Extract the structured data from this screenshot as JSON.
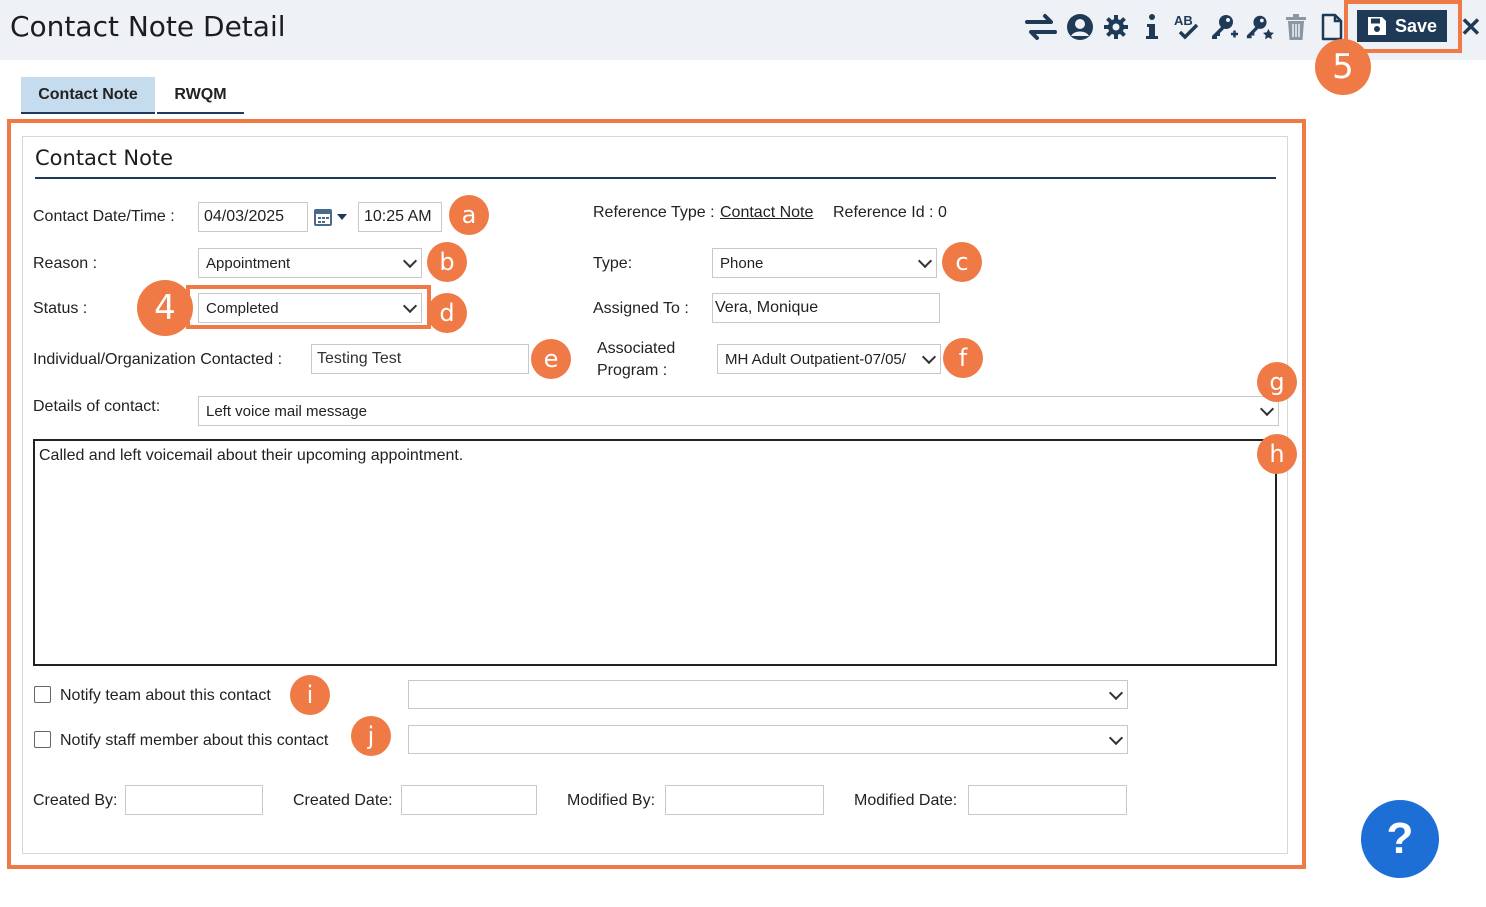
{
  "window": {
    "title": "Contact Note Detail"
  },
  "toolbar": {
    "icons": [
      "transfer-icon",
      "user-icon",
      "gear-icon",
      "info-icon",
      "spellcheck-icon",
      "key-add-icon",
      "key-star-icon",
      "trash-icon",
      "document-icon"
    ],
    "save_label": "Save",
    "close_glyph": "✕"
  },
  "tabs": [
    {
      "label": "Contact Note",
      "active": true
    },
    {
      "label": "RWQM",
      "active": false
    }
  ],
  "section": {
    "title": "Contact Note"
  },
  "form": {
    "contact_datetime_label": "Contact Date/Time :",
    "date_value": "04/03/2025",
    "time_value": "10:25 AM",
    "reference_type_label": "Reference Type :",
    "reference_type_value": "Contact Note",
    "reference_id_label": "Reference Id : 0",
    "reason_label": "Reason :",
    "reason_value": "Appointment",
    "type_label": "Type:",
    "type_value": "Phone",
    "status_label": "Status :",
    "status_value": "Completed",
    "assigned_to_label": "Assigned To :",
    "assigned_to_value": "Vera, Monique",
    "individual_label": "Individual/Organization Contacted :",
    "individual_value": "Testing Test",
    "associated_program_label_1": "Associated",
    "associated_program_label_2": "Program :",
    "associated_program_value": "MH Adult Outpatient-07/05/",
    "details_label": "Details of contact:",
    "details_value": "Left voice mail message",
    "note_text": "Called and left voicemail about their upcoming appointment.",
    "notify_team_label": "Notify team about this contact",
    "notify_team_checked": false,
    "notify_team_value": "",
    "notify_staff_label": "Notify staff member about this contact",
    "notify_staff_checked": false,
    "notify_staff_value": "",
    "created_by_label": "Created By:",
    "created_by_value": "",
    "created_date_label": "Created Date:",
    "created_date_value": "",
    "modified_by_label": "Modified By:",
    "modified_by_value": "",
    "modified_date_label": "Modified Date:",
    "modified_date_value": ""
  },
  "annotations": {
    "step_4": "4",
    "step_5": "5",
    "a": "a",
    "b": "b",
    "c": "c",
    "d": "d",
    "e": "e",
    "f": "f",
    "g": "g",
    "h": "h",
    "i": "i",
    "j": "j",
    "color": "#ef7a45"
  },
  "help": {
    "label": "?"
  },
  "colors": {
    "header_bg": "#eef2f6",
    "primary": "#1f3a56",
    "tab_active_bg": "#c5dbee",
    "help_bg": "#1d6fd6"
  }
}
